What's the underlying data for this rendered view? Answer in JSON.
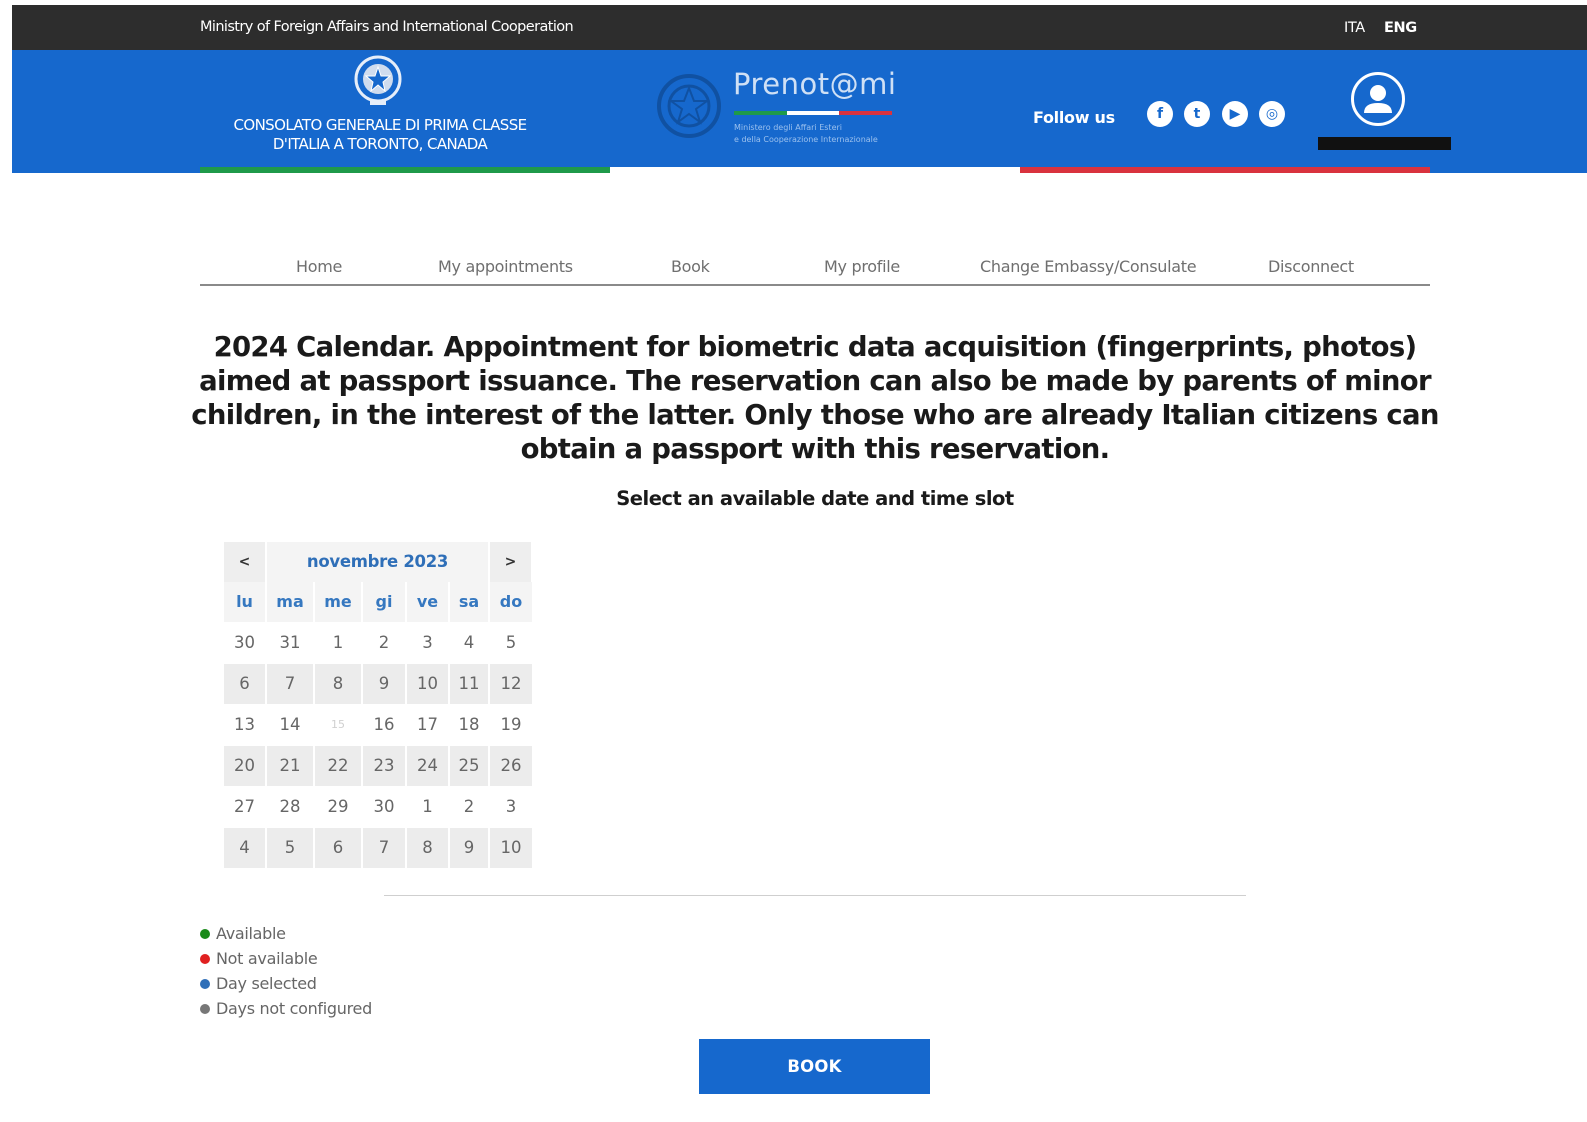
{
  "topbar": {
    "ministry": "Ministry of Foreign Affairs and International Cooperation",
    "lang_ita": "ITA",
    "lang_eng": "ENG"
  },
  "header": {
    "consulate": "CONSOLATO GENERALE DI PRIMA CLASSE D'ITALIA A TORONTO, CANADA",
    "brand": "Prenot@mi",
    "brand_sub_1": "Ministero degli Affari Esteri",
    "brand_sub_2": "e della Cooperazione Internazionale",
    "follow_us": "Follow us",
    "social": [
      {
        "name": "facebook-icon",
        "glyph": "f"
      },
      {
        "name": "twitter-icon",
        "glyph": "t"
      },
      {
        "name": "youtube-icon",
        "glyph": "▶"
      },
      {
        "name": "instagram-icon",
        "glyph": "◎"
      }
    ]
  },
  "colors": {
    "header_blue": "#1668cd",
    "topbar": "#2d2d2d",
    "flag_green": "#1f9a4a",
    "flag_white": "#ffffff",
    "flag_red": "#d9323e",
    "available": "#1a8a1a",
    "not_available": "#e02020",
    "day_selected": "#2f6fb8",
    "not_configured": "#777777"
  },
  "nav": {
    "home": "Home",
    "my_appointments": "My appointments",
    "book": "Book",
    "my_profile": "My profile",
    "change": "Change Embassy/Consulate",
    "disconnect": "Disconnect"
  },
  "main": {
    "title": "2024 Calendar. Appointment for biometric data acquisition (fingerprints, photos) aimed at passport issuance. The reservation can also be made by parents of minor children, in the interest of the latter. Only those who are already Italian citizens can obtain a passport with this reservation.",
    "subtitle": "Select an available date and time slot"
  },
  "calendar": {
    "prev": "<",
    "next": ">",
    "month": "novembre 2023",
    "weekdays": [
      "lu",
      "ma",
      "me",
      "gi",
      "ve",
      "sa",
      "do"
    ],
    "weeks": [
      [
        "30",
        "31",
        "1",
        "2",
        "3",
        "4",
        "5"
      ],
      [
        "6",
        "7",
        "8",
        "9",
        "10",
        "11",
        "12"
      ],
      [
        "13",
        "14",
        "15",
        "16",
        "17",
        "18",
        "19"
      ],
      [
        "20",
        "21",
        "22",
        "23",
        "24",
        "25",
        "26"
      ],
      [
        "27",
        "28",
        "29",
        "30",
        "1",
        "2",
        "3"
      ],
      [
        "4",
        "5",
        "6",
        "7",
        "8",
        "9",
        "10"
      ]
    ]
  },
  "legend": {
    "available": "Available",
    "not_available": "Not available",
    "day_selected": "Day selected",
    "not_configured": "Days not configured"
  },
  "book_button": "BOOK"
}
